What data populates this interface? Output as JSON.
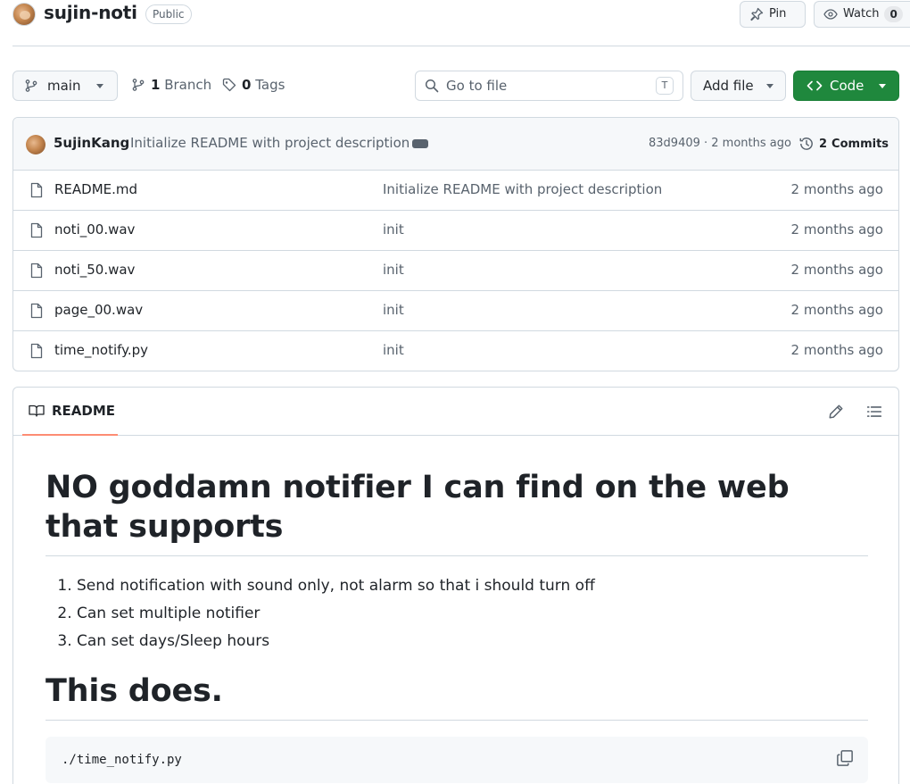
{
  "repo": {
    "name": "sujin-noti",
    "visibility": "Public"
  },
  "header": {
    "pin_label": "Pin",
    "watch_label": "Watch",
    "watch_count": "0"
  },
  "toolbar": {
    "branch": "main",
    "branch_count": "1",
    "branch_label": "Branch",
    "tag_count": "0",
    "tag_label": "Tags",
    "goto_placeholder": "Go to file",
    "goto_shortcut": "T",
    "add_file_label": "Add file",
    "code_label": "Code"
  },
  "commit": {
    "author": "5ujinKang",
    "message": "Initialize README with project description",
    "sha_time": "83d9409 · 2 months ago",
    "commits_count": "2",
    "commits_label": "Commits"
  },
  "files": [
    {
      "name": "README.md",
      "message": "Initialize README with project description",
      "time": "2 months ago"
    },
    {
      "name": "noti_00.wav",
      "message": "init",
      "time": "2 months ago"
    },
    {
      "name": "noti_50.wav",
      "message": "init",
      "time": "2 months ago"
    },
    {
      "name": "page_00.wav",
      "message": "init",
      "time": "2 months ago"
    },
    {
      "name": "time_notify.py",
      "message": "init",
      "time": "2 months ago"
    }
  ],
  "readme": {
    "tab_label": "README",
    "heading1": "NO goddamn notifier I can find on the web that supports",
    "list": [
      "Send notification with sound only, not alarm so that i should turn off",
      "Can set multiple notifier",
      "Can set days/Sleep hours"
    ],
    "heading2": "This does.",
    "code": "./time_notify.py"
  },
  "colors": {
    "primary_button": "#1f883d",
    "tab_underline": "#fd8c73",
    "border": "#d1d9e0"
  }
}
